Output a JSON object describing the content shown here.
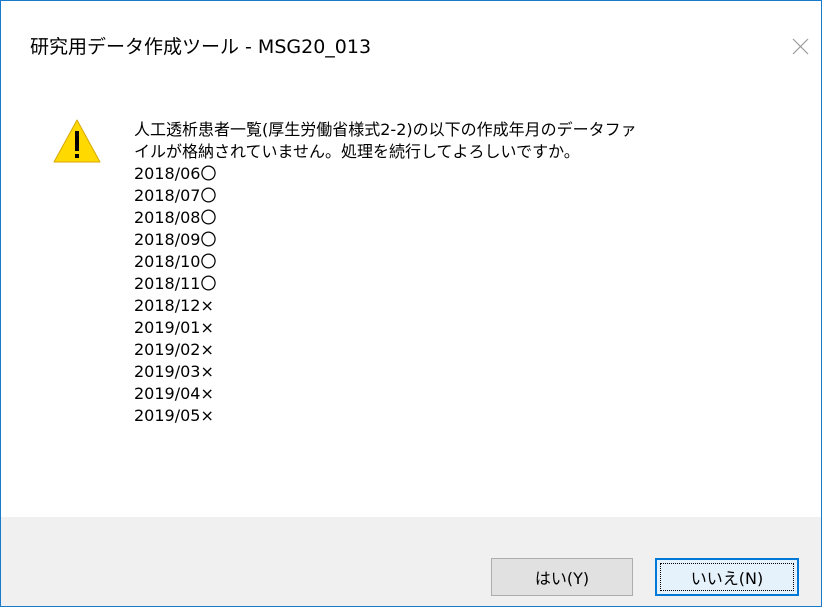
{
  "window": {
    "title": "研究用データ作成ツール - MSG20_013"
  },
  "icons": {
    "warning": "warning-icon",
    "close": "close-icon"
  },
  "message": {
    "lines": [
      "人工透析患者一覧(厚生労働省様式2-2)の以下の作成年月のデータファ",
      "イルが格納されていません。処理を続行してよろしいですか。",
      "2018/06〇",
      "2018/07〇",
      "2018/08〇",
      "2018/09〇",
      "2018/10〇",
      "2018/11〇",
      "2018/12×",
      "2019/01×",
      "2019/02×",
      "2019/03×",
      "2019/04×",
      "2019/05×"
    ]
  },
  "buttons": {
    "yes_label": "はい(Y)",
    "no_label": "いいえ(N)"
  },
  "colors": {
    "window_border": "#1979ca",
    "footer_bg": "#f0f0f0",
    "focus_border": "#0078d7",
    "warning_fill": "#ffd900"
  }
}
